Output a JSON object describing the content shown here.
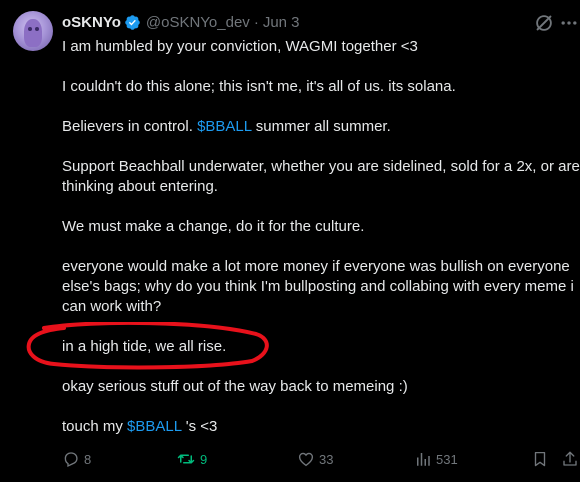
{
  "tweet": {
    "display_name": "oSKNYo",
    "handle": "@oSKNYo_dev",
    "separator": "·",
    "date": "Jun 3",
    "paragraphs": [
      {
        "parts": [
          {
            "text": "I am humbled by your conviction, WAGMI together <3"
          }
        ]
      },
      {
        "parts": [
          {
            "text": "I couldn't do this alone; this isn't me, it's all of us. its solana."
          }
        ]
      },
      {
        "parts": [
          {
            "text": "Believers in control. "
          },
          {
            "text": "$BBALL",
            "cashtag": true
          },
          {
            "text": " summer all summer."
          }
        ]
      },
      {
        "parts": [
          {
            "text": "Support Beachball underwater, whether you are sidelined, sold for a 2x, or are thinking about entering."
          }
        ]
      },
      {
        "parts": [
          {
            "text": "We must make a change, do it for the culture."
          }
        ]
      },
      {
        "parts": [
          {
            "text": "everyone would make a lot more money if everyone was bullish on everyone else's bags; why do you think I'm bullposting and collabing with every meme i can work with?"
          }
        ]
      },
      {
        "parts": [
          {
            "text": "in a high tide, we all rise."
          }
        ]
      },
      {
        "parts": [
          {
            "text": "okay serious stuff out of the way back to memeing :)"
          }
        ]
      },
      {
        "parts": [
          {
            "text": "touch my "
          },
          {
            "text": "$BBALL",
            "cashtag": true
          },
          {
            "text": " 's <3"
          }
        ]
      }
    ]
  },
  "actions": {
    "replies": "8",
    "retweets": "9",
    "likes": "33",
    "views": "531"
  },
  "colors": {
    "background": "#000000",
    "text": "#e7e9ea",
    "muted": "#71767b",
    "link": "#1d9bf0",
    "retweet_active": "#00ba7c",
    "highlight_circle": "#e8111b"
  },
  "icons": {
    "verified": "verified-badge-icon",
    "grok": "grok-icon",
    "more": "more-icon",
    "reply": "reply-icon",
    "retweet": "retweet-icon",
    "like": "like-icon",
    "views": "views-icon",
    "bookmark": "bookmark-icon",
    "share": "share-icon"
  }
}
